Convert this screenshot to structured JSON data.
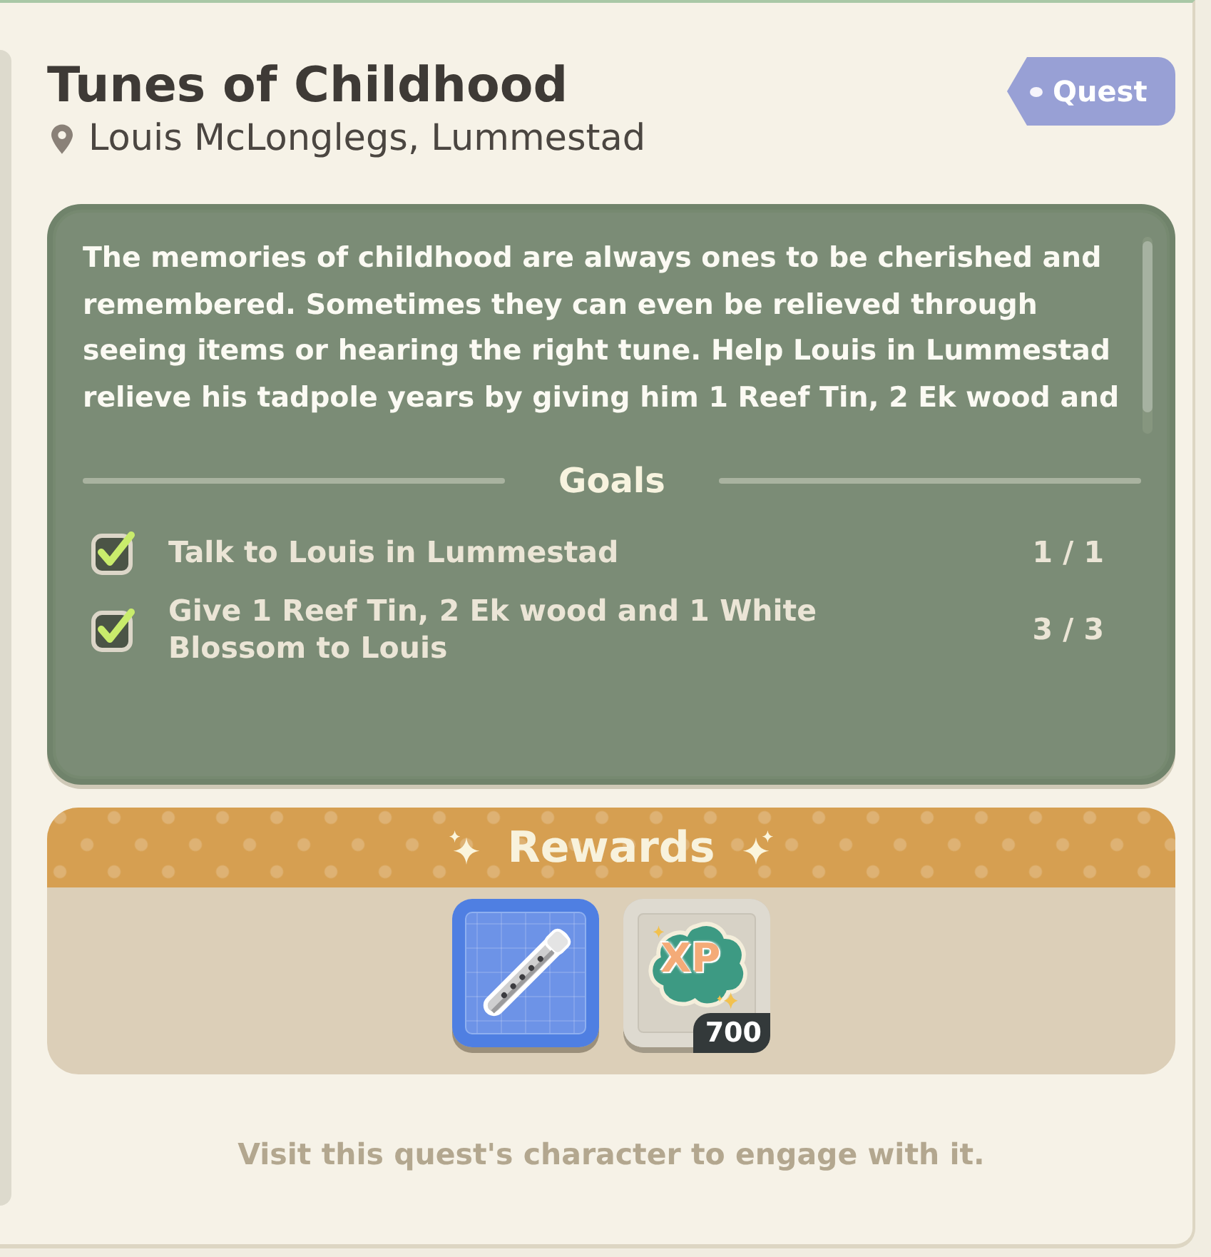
{
  "quest": {
    "title": "Tunes of Childhood",
    "location": "Louis McLonglegs, Lummestad",
    "tag": "Quest"
  },
  "description": "The memories of childhood are always ones to be cherished and remembered. Sometimes they can even be relieved through seeing items or hearing the right tune. Help Louis in Lummestad relieve his tadpole years by giving him 1 Reef Tin, 2 Ek wood and",
  "goals": {
    "title": "Goals",
    "items": [
      {
        "text": "Talk to Louis in Lummestad",
        "progress": "1 / 1",
        "checked": true
      },
      {
        "text": "Give 1 Reef Tin, 2 Ek wood and 1 White Blossom to Louis",
        "progress": "3 / 3",
        "checked": true
      }
    ]
  },
  "rewards": {
    "title": "Rewards",
    "items": [
      {
        "kind": "item"
      },
      {
        "kind": "xp",
        "label": "XP",
        "count": "700"
      }
    ]
  },
  "footer": "Visit this quest's character to engage with it."
}
